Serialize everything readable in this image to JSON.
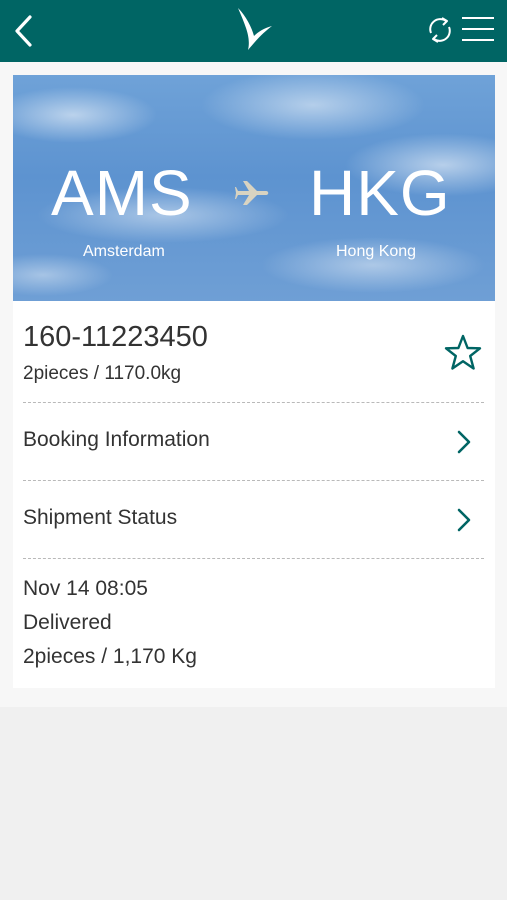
{
  "header": {
    "back_icon": "chevron-left-icon",
    "logo_icon": "brushwing-logo",
    "refresh_icon": "refresh-icon",
    "menu_icon": "hamburger-menu-icon",
    "bar_color": "#006564"
  },
  "route": {
    "origin_code": "AMS",
    "origin_city": "Amsterdam",
    "destination_code": "HKG",
    "destination_city": "Hong Kong",
    "route_icon": "airplane-icon"
  },
  "shipment": {
    "awb_number": "160-11223450",
    "summary": "2pieces / 1170.0kg",
    "favorite_icon": "star-outline-icon"
  },
  "links": [
    {
      "label": "Booking Information",
      "icon": "chevron-right-icon"
    },
    {
      "label": "Shipment Status",
      "icon": "chevron-right-icon"
    }
  ],
  "latest_status": {
    "datetime": "Nov 14 08:05",
    "status": "Delivered",
    "pieces_weight": "2pieces / 1,170 Kg"
  },
  "colors": {
    "accent": "#006564",
    "text": "#333333"
  }
}
